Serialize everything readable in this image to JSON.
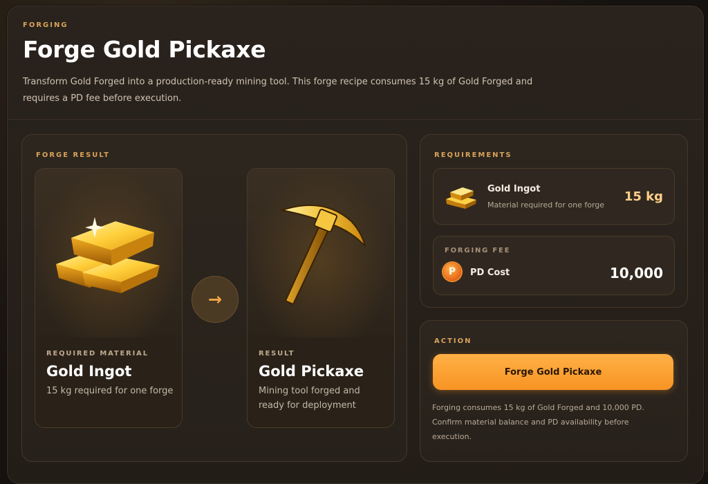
{
  "header": {
    "eyebrow": "FORGING",
    "title": "Forge Gold Pickaxe",
    "description": "Transform Gold Forged into a production-ready mining tool. This forge recipe consumes 15 kg of Gold Forged and requires a PD fee before execution."
  },
  "forge_result": {
    "label": "FORGE RESULT",
    "input": {
      "eyebrow": "REQUIRED MATERIAL",
      "name": "Gold Ingot",
      "description": "15 kg required for one forge",
      "icon": "gold-ingot-icon"
    },
    "arrow_icon": "→",
    "output": {
      "eyebrow": "RESULT",
      "name": "Gold Pickaxe",
      "description": "Mining tool forged and ready for deployment",
      "icon": "gold-pickaxe-icon"
    }
  },
  "requirements": {
    "label": "REQUIREMENTS",
    "material": {
      "name": "Gold Ingot",
      "subtitle": "Material required for one forge",
      "quantity": "15 kg"
    },
    "fee": {
      "label": "FORGING FEE",
      "coin_symbol": "P",
      "name": "PD Cost",
      "value": "10,000"
    }
  },
  "action": {
    "label": "ACTION",
    "button_label": "Forge Gold Pickaxe",
    "note": "Forging consumes 15 kg of Gold Forged and 10,000 PD. Confirm material balance and PD availability before execution."
  },
  "colors": {
    "accent": "#f79424",
    "eyebrow": "#d9a35a",
    "background": "#161210",
    "panel": "#2a231d"
  }
}
